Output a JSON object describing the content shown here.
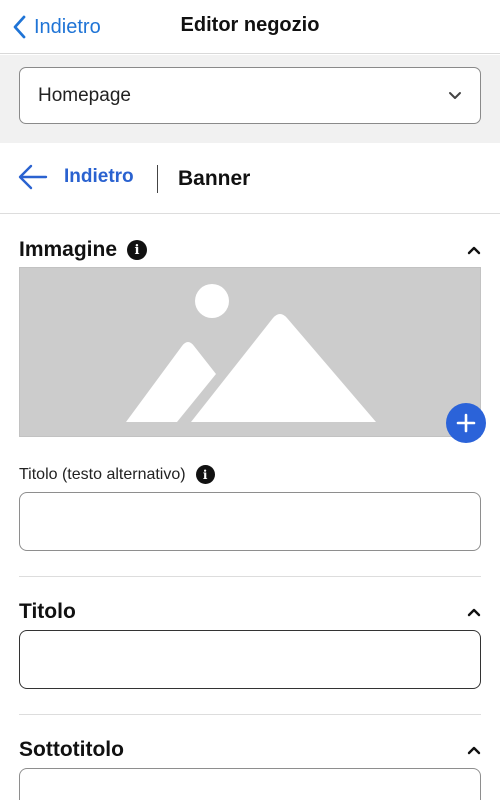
{
  "nav": {
    "back_label": "Indietro",
    "title": "Editor negozio"
  },
  "page_selector": {
    "value": "Homepage"
  },
  "section": {
    "back_label": "Indietro",
    "current": "Banner"
  },
  "image_section": {
    "heading": "Immagine",
    "alt_label": "Titolo (testo alternativo)",
    "alt_value": ""
  },
  "title_section": {
    "heading": "Titolo",
    "value": ""
  },
  "subtitle_section": {
    "heading": "Sottotitolo",
    "value": ""
  },
  "colors": {
    "accent": "#1f74d6",
    "button": "#2b63d9",
    "placeholder": "#cccccc"
  },
  "icons": {
    "back": "chevron-left-icon",
    "arrow_back": "arrow-left-icon",
    "dropdown": "chevron-down-icon",
    "collapse": "chevron-up-icon",
    "info": "info-icon",
    "add": "plus-icon",
    "image": "image-placeholder-icon"
  }
}
